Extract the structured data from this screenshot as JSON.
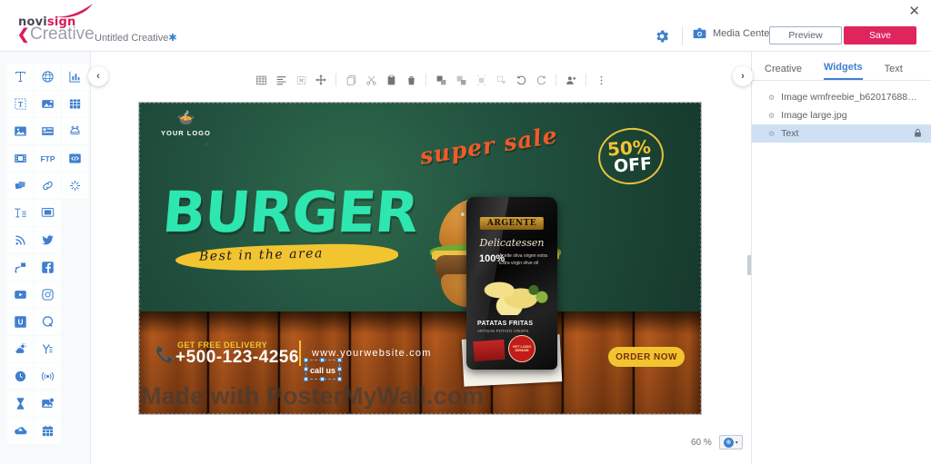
{
  "header": {
    "logo": {
      "part1": "novi",
      "part2": "sign",
      "icon": "swoosh-logo"
    },
    "back_label": "Creative",
    "doc_title": "Untitled Creative",
    "doc_modified_mark": "✱",
    "close_icon": "✕",
    "gear_icon": "gear-icon",
    "media_center_label": "Media Center",
    "media_center_icon": "camera-icon",
    "preview_label": "Preview",
    "save_label": "Save",
    "accent_color": "#e0245e",
    "link_color": "#3f7fd0"
  },
  "sidebar": {
    "tools": [
      {
        "name": "text-tool",
        "glyph": "T"
      },
      {
        "name": "web-page-tool",
        "glyph": "globe"
      },
      {
        "name": "chart-tool",
        "glyph": "chart"
      },
      {
        "name": "scrolling-text-tool",
        "glyph": "scroll-text"
      },
      {
        "name": "image-effect-tool",
        "glyph": "image-fx"
      },
      {
        "name": "table-tool",
        "glyph": "table"
      },
      {
        "name": "image-tool",
        "glyph": "picture"
      },
      {
        "name": "slideshow-tool",
        "glyph": "slideshow"
      },
      {
        "name": "stickers-tool",
        "glyph": "stickers"
      },
      {
        "name": "video-tool",
        "glyph": "film"
      },
      {
        "name": "ftp-tool",
        "glyph": "FTP"
      },
      {
        "name": "html-embed-tool",
        "glyph": "</>"
      },
      {
        "name": "layers-tool",
        "glyph": "layers"
      },
      {
        "name": "link-tool",
        "glyph": "link"
      },
      {
        "name": "effects-tool",
        "glyph": "sparkle"
      },
      {
        "name": "rich-text-tool",
        "glyph": "Te"
      },
      {
        "name": "screen-tool",
        "glyph": "monitor"
      },
      {
        "name": "rss-tool",
        "glyph": "rss"
      },
      {
        "name": "twitter-tool",
        "glyph": "twitter"
      },
      {
        "name": "rss-feed-tool",
        "glyph": "rss-feed"
      },
      {
        "name": "facebook-tool",
        "glyph": "facebook"
      },
      {
        "name": "youtube-tool",
        "glyph": "youtube"
      },
      {
        "name": "instagram-tool",
        "glyph": "instagram"
      },
      {
        "name": "unsplash-tool",
        "glyph": "U"
      },
      {
        "name": "quote-tool",
        "glyph": "Q"
      },
      {
        "name": "weather-tool",
        "glyph": "weather"
      },
      {
        "name": "yammer-tool",
        "glyph": "yammer"
      },
      {
        "name": "clock-tool",
        "glyph": "clock"
      },
      {
        "name": "live-stream-tool",
        "glyph": "broadcast"
      },
      {
        "name": "countdown-tool",
        "glyph": "hourglass"
      },
      {
        "name": "dynamic-image-tool",
        "glyph": "dynamic-image"
      },
      {
        "name": "upload-tool",
        "glyph": "upload"
      },
      {
        "name": "calendar-tool",
        "glyph": "calendar"
      }
    ]
  },
  "canvas_toolbar": {
    "collapse_left_icon": "‹",
    "collapse_right_icon": "›",
    "buttons": [
      {
        "name": "grid-button",
        "icon": "grid"
      },
      {
        "name": "align-button",
        "icon": "align"
      },
      {
        "name": "fit-button",
        "icon": "fit-frame"
      },
      {
        "name": "move-button",
        "icon": "move-arrows"
      },
      {
        "name": "copy-style-button",
        "icon": "copy-style"
      },
      {
        "name": "cut-button",
        "icon": "scissors"
      },
      {
        "name": "paste-button",
        "icon": "paste"
      },
      {
        "name": "delete-button",
        "icon": "trash"
      },
      {
        "name": "bring-forward-button",
        "icon": "bring-forward"
      },
      {
        "name": "send-backward-button",
        "icon": "send-backward"
      },
      {
        "name": "bring-front-button",
        "icon": "bring-front"
      },
      {
        "name": "send-back-button",
        "icon": "send-back"
      },
      {
        "name": "undo-button",
        "icon": "undo"
      },
      {
        "name": "redo-button",
        "icon": "redo"
      },
      {
        "name": "add-user-button",
        "icon": "add-user"
      },
      {
        "name": "more-button",
        "icon": "kebab-menu"
      }
    ]
  },
  "poster": {
    "logo_placeholder": "YOUR LOGO",
    "logo_icon": "pot-icon",
    "headline": "BURGER",
    "tagline": "Best in the area",
    "badge_sale": "super sale",
    "badge_percent": "50%",
    "badge_off": "OFF",
    "delivery_label": "GET FREE DELIVERY",
    "phone": "+500-123-4256",
    "phone_icon": "phone-icon",
    "website": "www.yourwebsite.com",
    "selected_text": "call us",
    "cta": "ORDER NOW",
    "watermark": "Made with PosterMyWall.com",
    "product": {
      "brand": "ARGENTE",
      "line": "Delicatessen",
      "percent": "100%",
      "oil_text_es": "Aceite oliva virgen extra",
      "oil_text_en": "Extra virgin olive oil",
      "product_name": "PATATAS FRITAS",
      "product_sub": "ARTISAN POTATO CRISPS",
      "seal_text": "VET LOGO DENOM"
    },
    "colors": {
      "green_bg": "#235340",
      "mint": "#2ee6b0",
      "yellow": "#f2c430",
      "orange": "#f05a28",
      "wood": "#a8541a"
    }
  },
  "zoom": {
    "level": "60 %",
    "control_icon": "zoom-icon",
    "caret_icon": "▾"
  },
  "right_panel": {
    "tabs": [
      {
        "label": "Creative",
        "active": false
      },
      {
        "label": "Widgets",
        "active": true
      },
      {
        "label": "Text",
        "active": false
      }
    ],
    "widgets": [
      {
        "label": "Image wmfreebie_b62017688b4ab56…",
        "selected": false,
        "locked": false
      },
      {
        "label": "Image large.jpg",
        "selected": false,
        "locked": false
      },
      {
        "label": "Text",
        "selected": true,
        "locked": true
      }
    ],
    "grip_icon": "⚙",
    "lock_icon": "🔒"
  }
}
